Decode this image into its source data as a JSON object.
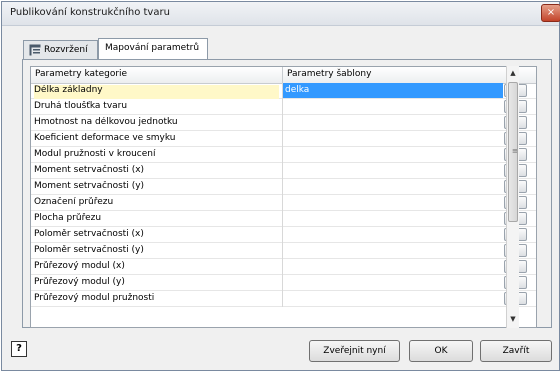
{
  "window": {
    "title": "Publikování konstrukčního tvaru",
    "close_label": "×"
  },
  "tabs": [
    {
      "label": "Rozvržení"
    },
    {
      "label": "Mapování parametrů"
    }
  ],
  "grid": {
    "headers": [
      "Parametry kategorie",
      "Parametry šablony"
    ],
    "rows": [
      {
        "category": "Délka základny",
        "template": "delka"
      },
      {
        "category": "Druhá tloušťka tvaru",
        "template": ""
      },
      {
        "category": "Hmotnost na délkovou jednotku",
        "template": ""
      },
      {
        "category": "Koeficient deformace ve smyku",
        "template": ""
      },
      {
        "category": "Modul pružnosti v kroucení",
        "template": ""
      },
      {
        "category": "Moment setrvačnosti (x)",
        "template": ""
      },
      {
        "category": "Moment setrvačnosti (y)",
        "template": ""
      },
      {
        "category": "Označení průřezu",
        "template": ""
      },
      {
        "category": "Plocha průřezu",
        "template": ""
      },
      {
        "category": "Poloměr setrvačnosti (x)",
        "template": ""
      },
      {
        "category": "Poloměr setrvačnosti (y)",
        "template": ""
      },
      {
        "category": "Průřezový modul (x)",
        "template": ""
      },
      {
        "category": "Průřezový modul (y)",
        "template": ""
      },
      {
        "category": "Průřezový modul pružnosti",
        "template": ""
      }
    ],
    "browse_label": "..."
  },
  "buttons": {
    "help": "?",
    "publish": "Zveřejnit nyní",
    "ok": "OK",
    "close": "Zavřít"
  },
  "icons": {
    "scroll_up": "up-arrow-icon",
    "scroll_down": "down-arrow-icon",
    "tab_layout": "layout-icon"
  }
}
